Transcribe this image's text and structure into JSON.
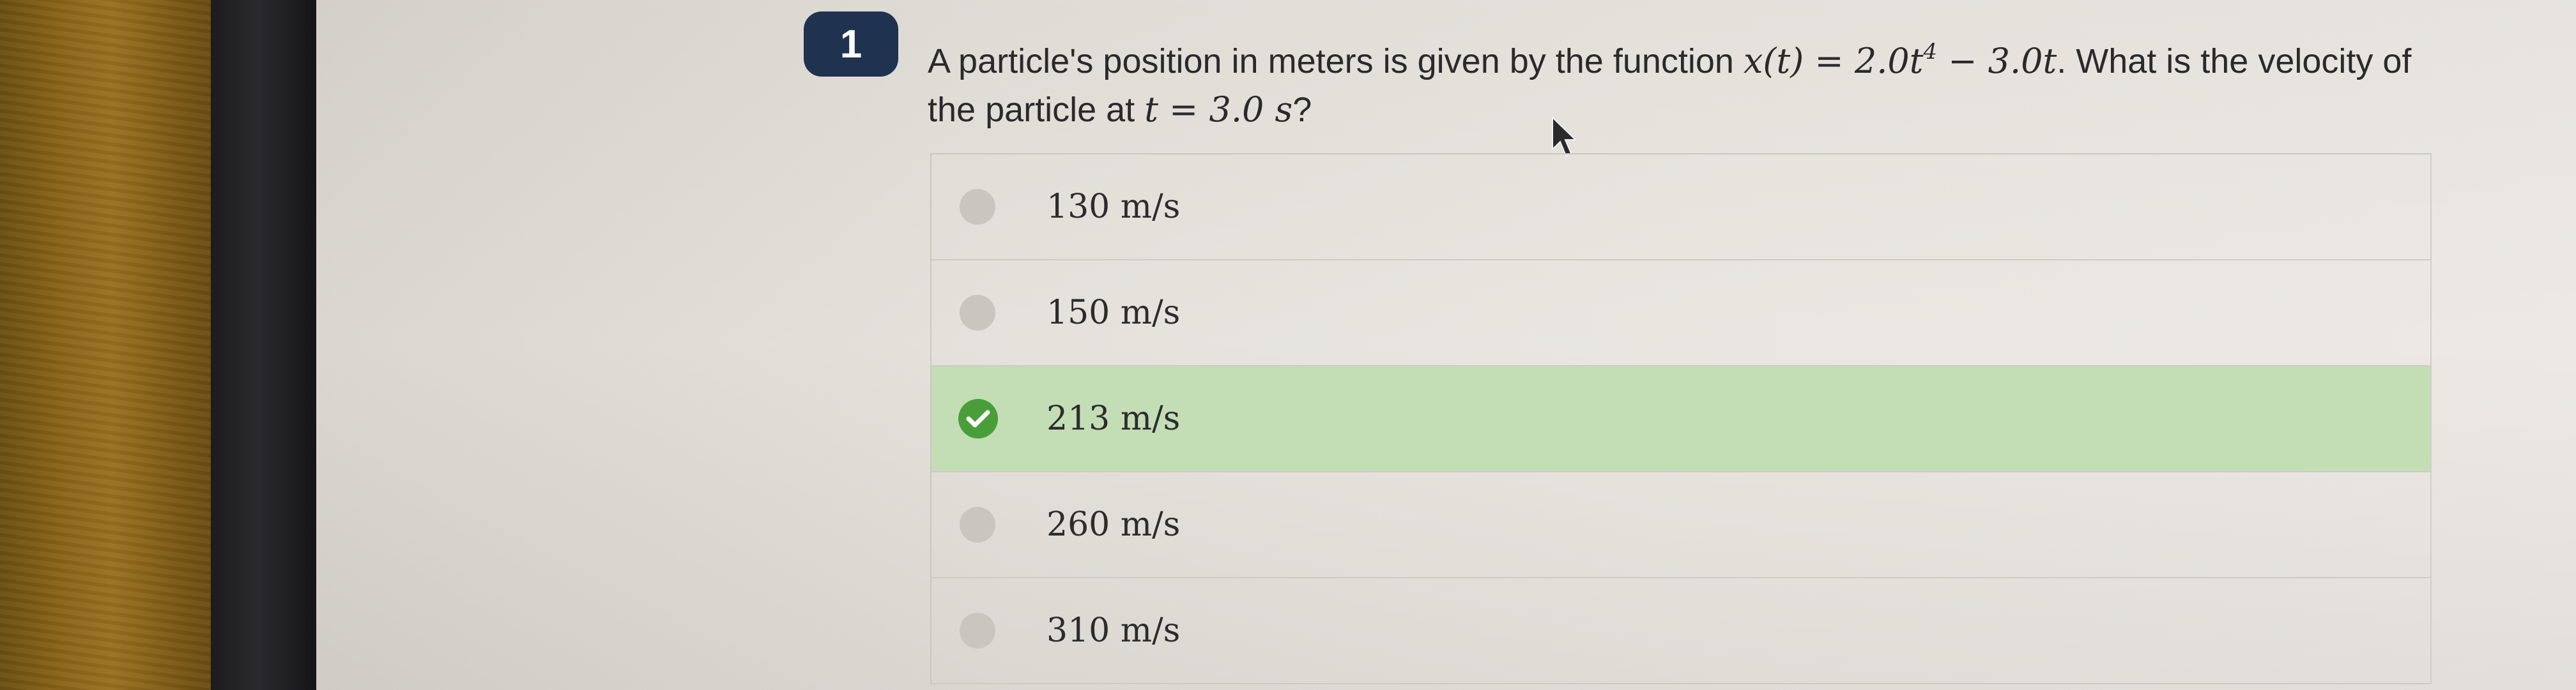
{
  "question": {
    "number": "1",
    "text_before": "A particle's position in meters is given by the function ",
    "function": "x(t) = 2.0t",
    "exponent": "4",
    "function_tail": " − 3.0t",
    "text_after": ". What is the velocity of the particle at ",
    "time_value": "t = 3.0 s",
    "question_mark": "?"
  },
  "options": [
    {
      "label": "130 m/s",
      "correct": false
    },
    {
      "label": "150 m/s",
      "correct": false
    },
    {
      "label": "213 m/s",
      "correct": true
    },
    {
      "label": "260 m/s",
      "correct": false
    },
    {
      "label": "310 m/s",
      "correct": false
    }
  ],
  "colors": {
    "badge": "#1f3350",
    "correct_bg": "#c3ddb5",
    "check": "#4a9e3a"
  }
}
